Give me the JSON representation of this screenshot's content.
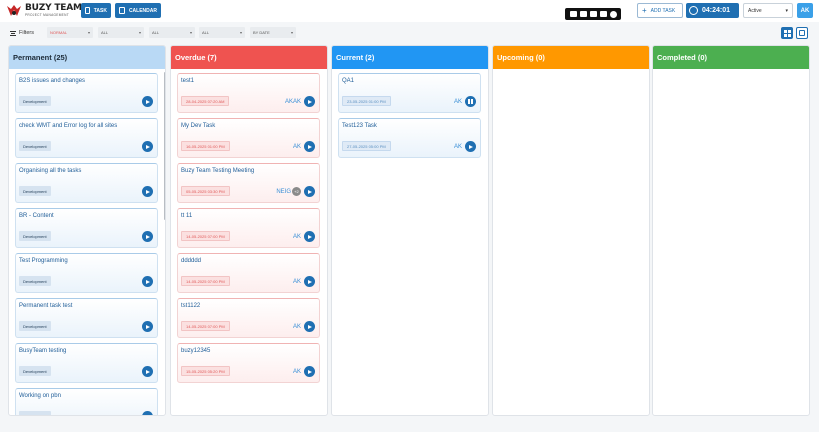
{
  "app": {
    "logo_title": "BUZY TEAM",
    "logo_subtitle": "PROJECT MANAGEMENT"
  },
  "nav": {
    "task_label": "TASK",
    "calendar_label": "CALENDAR"
  },
  "header": {
    "add_task_label": "ADD TASK",
    "timer_value": "04:24:01",
    "status_value": "Active",
    "user_initials": "AK"
  },
  "filters": {
    "label": "Filters",
    "priority": "NORMAL",
    "filter2": "ALL",
    "filter3": "ALL",
    "filter4": "ALL",
    "sort": "BY DATE"
  },
  "colors": {
    "primary": "#1f6fb2",
    "permanent": "#b9d9f5",
    "overdue": "#ef5350",
    "current": "#2196f3",
    "upcoming": "#ff9800",
    "completed": "#4caf50"
  },
  "columns": {
    "permanent": {
      "title": "Permanent (25)",
      "cards": [
        {
          "title": "B2S issues and changes",
          "tag": "Development"
        },
        {
          "title": "check WMT and Error log for all sites",
          "tag": "Development"
        },
        {
          "title": "Organising all the tasks",
          "tag": "Development"
        },
        {
          "title": "BR - Content",
          "tag": "Development"
        },
        {
          "title": "Test Programming",
          "tag": "Development"
        },
        {
          "title": "Permanent task test",
          "tag": "Development"
        },
        {
          "title": "BusyTeam testing",
          "tag": "Development"
        },
        {
          "title": "Working on pbn",
          "tag": "Development"
        }
      ]
    },
    "overdue": {
      "title": "Overdue (7)",
      "cards": [
        {
          "title": "test1",
          "date": "28-04-2025 07:20 AM",
          "assignee": "AKAK"
        },
        {
          "title": "My Dev Task",
          "date": "16-05-2025 01:00 PM",
          "assignee": "AK"
        },
        {
          "title": "Buzy Team Testing Meeting",
          "date": "05-05-2025 03:30 PM",
          "assignee": "NEIG",
          "extra": "+2"
        },
        {
          "title": "tt 11",
          "date": "14-05-2025 07:00 PM",
          "assignee": "AK"
        },
        {
          "title": "dddddd",
          "date": "14-05-2025 07:00 PM",
          "assignee": "AK"
        },
        {
          "title": "tst1122",
          "date": "14-05-2025 07:00 PM",
          "assignee": "AK"
        },
        {
          "title": "buzy12345",
          "date": "15-05-2025 05:20 PM",
          "assignee": "AK"
        }
      ]
    },
    "current": {
      "title": "Current (2)",
      "cards": [
        {
          "title": "QA1",
          "date": "23-05-2025 01:00 PM",
          "assignee": "AK",
          "state": "running"
        },
        {
          "title": "Test123 Task",
          "date": "27-05-2025 05:00 PM",
          "assignee": "AK",
          "state": "paused"
        }
      ]
    },
    "upcoming": {
      "title": "Upcoming (0)"
    },
    "completed": {
      "title": "Completed (0)"
    }
  }
}
